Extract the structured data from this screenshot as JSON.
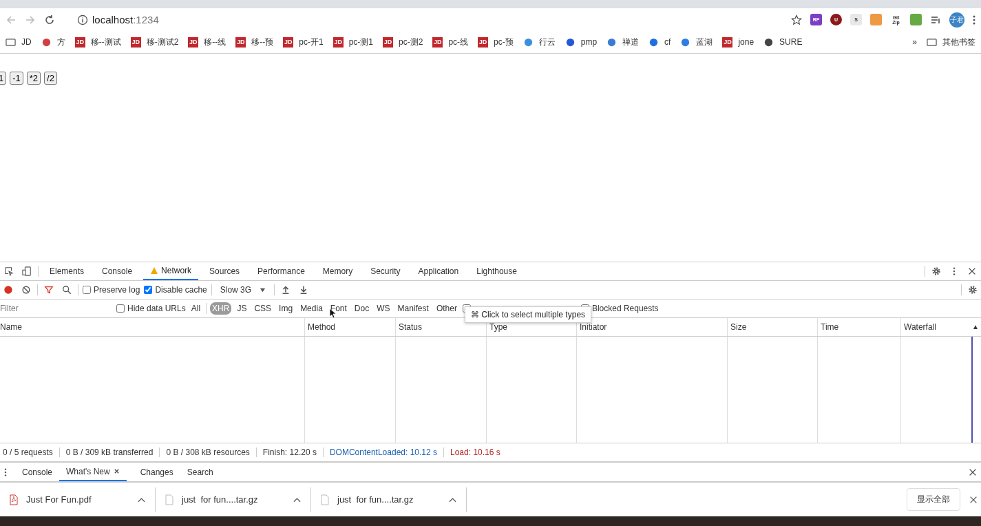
{
  "toolbar": {
    "url_host": "localhost",
    "url_port": ":1234",
    "avatar": "子君",
    "extensions": [
      {
        "kind": "rp",
        "label": "RP"
      },
      {
        "kind": "u",
        "label": "U"
      },
      {
        "kind": "s",
        "label": "S"
      },
      {
        "kind": "pin"
      },
      {
        "kind": "gitzip",
        "label": "Git Zip"
      },
      {
        "kind": "grid"
      }
    ]
  },
  "bookmarks": {
    "items": [
      {
        "kind": "folder",
        "label": "JD"
      },
      {
        "kind": "xml",
        "label": "方"
      },
      {
        "kind": "jd",
        "icon_text": "JD",
        "label": "移--测试"
      },
      {
        "kind": "jd",
        "icon_text": "JD",
        "label": "移-测试2"
      },
      {
        "kind": "jd",
        "icon_text": "JD",
        "label": "移--线"
      },
      {
        "kind": "jd",
        "icon_text": "JD",
        "label": "移--预"
      },
      {
        "kind": "jd",
        "icon_text": "JD",
        "label": "pc-开1"
      },
      {
        "kind": "jd",
        "icon_text": "JD",
        "label": "pc-测1"
      },
      {
        "kind": "jd",
        "icon_text": "JD",
        "label": "pc-测2"
      },
      {
        "kind": "jd",
        "icon_text": "JD",
        "label": "pc-线"
      },
      {
        "kind": "jd",
        "icon_text": "JD",
        "label": "pc-预"
      },
      {
        "kind": "cloud",
        "label": "行云"
      },
      {
        "kind": "jdd",
        "label": "pmp"
      },
      {
        "kind": "globe",
        "label": "禅道"
      },
      {
        "kind": "cf",
        "label": "cf"
      },
      {
        "kind": "bird",
        "label": "蓝湖"
      },
      {
        "kind": "jd",
        "icon_text": "JD",
        "label": "jone"
      },
      {
        "kind": "world",
        "label": "SURE"
      }
    ],
    "overflow": "»",
    "other": "其他书签"
  },
  "page": {
    "buttons": [
      "1",
      "-1",
      "*2",
      "/2"
    ]
  },
  "devtools": {
    "tabs": [
      {
        "label": "Elements",
        "selected": false,
        "warning": false
      },
      {
        "label": "Console",
        "selected": false,
        "warning": false
      },
      {
        "label": "Network",
        "selected": true,
        "warning": true
      },
      {
        "label": "Sources",
        "selected": false,
        "warning": false
      },
      {
        "label": "Performance",
        "selected": false,
        "warning": false
      },
      {
        "label": "Memory",
        "selected": false,
        "warning": false
      },
      {
        "label": "Security",
        "selected": false,
        "warning": false
      },
      {
        "label": "Application",
        "selected": false,
        "warning": false
      },
      {
        "label": "Lighthouse",
        "selected": false,
        "warning": false
      }
    ],
    "recording": true,
    "preserve_log": {
      "label": "Preserve log",
      "checked": false
    },
    "disable_cache": {
      "label": "Disable cache",
      "checked": true
    },
    "throttle": "Slow 3G",
    "filter": {
      "placeholder": "Filter"
    },
    "hide_data_urls": {
      "label": "Hide data URLs",
      "checked": false
    },
    "types": [
      {
        "label": "All",
        "selected": false
      },
      {
        "label": "XHR",
        "selected": true
      },
      {
        "label": "JS",
        "selected": false
      },
      {
        "label": "CSS",
        "selected": false
      },
      {
        "label": "Img",
        "selected": false
      },
      {
        "label": "Media",
        "selected": false
      },
      {
        "label": "Font",
        "selected": false
      },
      {
        "label": "Doc",
        "selected": false
      },
      {
        "label": "WS",
        "selected": false
      },
      {
        "label": "Manifest",
        "selected": false
      },
      {
        "label": "Other",
        "selected": false
      }
    ],
    "blocked_cookies": {
      "checked": false
    },
    "blocked_requests": {
      "label": "Blocked Requests",
      "checked": false
    },
    "tooltip": "⌘ Click to select multiple types",
    "columns": [
      "Name",
      "Method",
      "Status",
      "Type",
      "Initiator",
      "Size",
      "Time",
      "Waterfall"
    ],
    "sort_indicator": "▲",
    "status": [
      {
        "text": "0 / 5 requests",
        "kind": "plain"
      },
      {
        "text": "0 B / 309 kB transferred",
        "kind": "plain"
      },
      {
        "text": "0 B / 308 kB resources",
        "kind": "plain"
      },
      {
        "text": "Finish: 12.20 s",
        "kind": "plain"
      },
      {
        "text": "DOMContentLoaded: 10.12 s",
        "kind": "blue"
      },
      {
        "text": "Load: 10.16 s",
        "kind": "red"
      }
    ],
    "drawer_tabs": [
      {
        "label": "Console",
        "selected": false,
        "closable": false
      },
      {
        "label": "What's New",
        "selected": true,
        "closable": true
      },
      {
        "label": "Changes",
        "selected": false,
        "closable": false
      },
      {
        "label": "Search",
        "selected": false,
        "closable": false
      }
    ]
  },
  "downloads": {
    "items": [
      {
        "kind": "pdf",
        "name": "Just For Fun.pdf"
      },
      {
        "kind": "file",
        "name": "just  for fun....tar.gz"
      },
      {
        "kind": "file",
        "name": "just  for fun....tar.gz"
      }
    ],
    "show_all": "显示全部"
  }
}
